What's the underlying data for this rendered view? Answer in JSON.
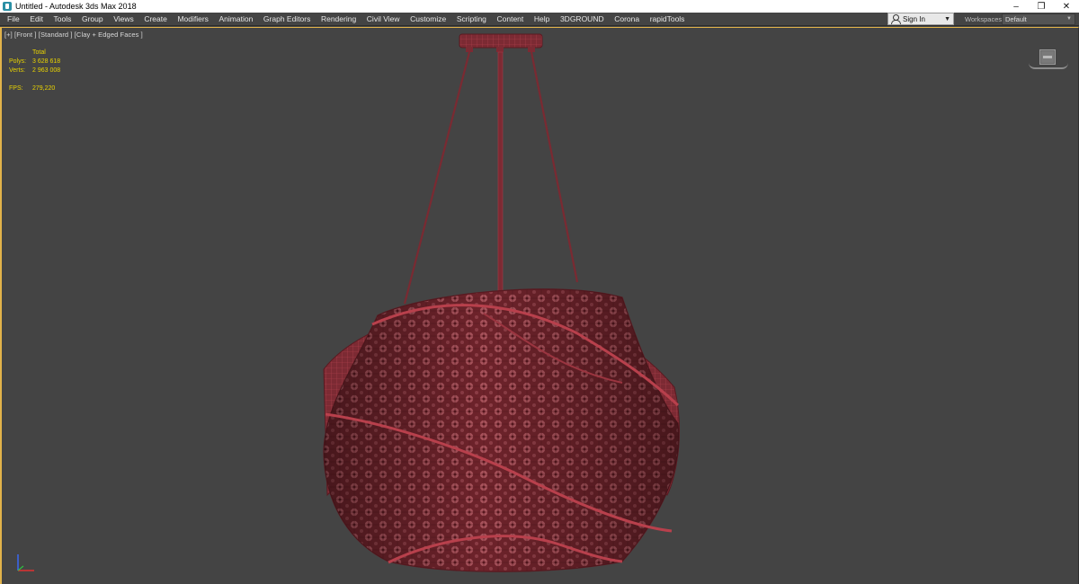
{
  "window": {
    "title": "Untitled - Autodesk 3ds Max 2018",
    "controls": [
      "–",
      "❐",
      "✕"
    ]
  },
  "menu": {
    "items": [
      "File",
      "Edit",
      "Tools",
      "Group",
      "Views",
      "Create",
      "Modifiers",
      "Animation",
      "Graph Editors",
      "Rendering",
      "Civil View",
      "Customize",
      "Scripting",
      "Content",
      "Help",
      "3DGROUND",
      "Corona",
      "rapidTools"
    ],
    "sign_in": "Sign In",
    "workspaces_label": "Workspaces:",
    "workspace_value": "Default"
  },
  "viewport": {
    "label": "[+] [Front ] [Standard ] [Clay + Edged Faces ]",
    "stats": {
      "header": "Total",
      "polys_label": "Polys:",
      "polys_value": "3 628 618",
      "verts_label": "Verts:",
      "verts_value": "2 963 008",
      "fps_label": "FPS:",
      "fps_value": "279,220"
    }
  },
  "colors": {
    "accent": "#e2b34a",
    "stats_text": "#e9d300",
    "background": "#444444",
    "mesh": "#7a2a32",
    "mesh_wire": "#b8404c"
  },
  "icons": {
    "app": "3dsmax-logo-icon",
    "user": "user-icon",
    "viewcube": "viewcube-icon",
    "axis": "axis-tripod-icon"
  }
}
